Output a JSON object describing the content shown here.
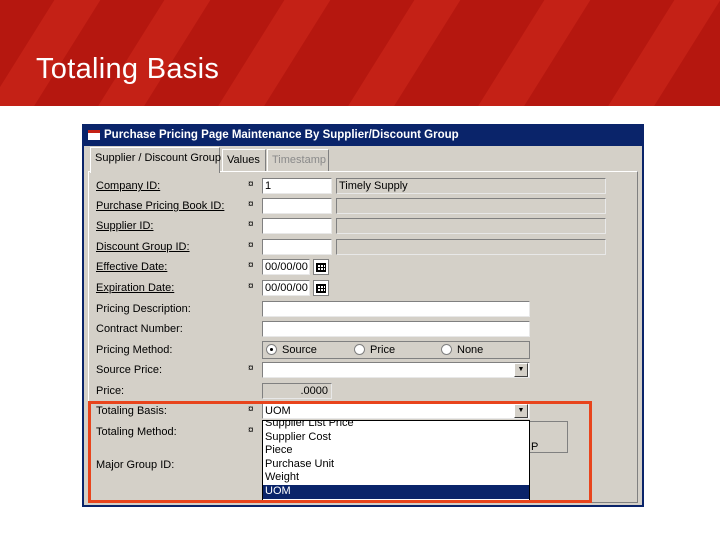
{
  "slide": {
    "title": "Totaling Basis"
  },
  "window": {
    "title": "Purchase Pricing Page Maintenance By Supplier/Discount Group"
  },
  "tabs": [
    {
      "label": "Supplier / Discount Group"
    },
    {
      "label": "Values"
    },
    {
      "label": "Timestamp"
    }
  ],
  "required_marker": "¤",
  "fields": {
    "company_id": {
      "label": "Company ID:",
      "value": "1",
      "description": "Timely Supply"
    },
    "purchase_pricing_book_id": {
      "label": "Purchase Pricing Book ID:",
      "value": ""
    },
    "supplier_id": {
      "label": "Supplier ID:",
      "value": ""
    },
    "discount_group_id": {
      "label": "Discount Group ID:",
      "value": ""
    },
    "effective_date": {
      "label": "Effective Date:",
      "value": "00/00/00"
    },
    "expiration_date": {
      "label": "Expiration Date:",
      "value": "00/00/00"
    },
    "pricing_description": {
      "label": "Pricing Description:",
      "value": ""
    },
    "contract_number": {
      "label": "Contract Number:",
      "value": ""
    },
    "pricing_method": {
      "label": "Pricing Method:",
      "options": [
        "Source",
        "Price",
        "None"
      ],
      "selected": "Source"
    },
    "source_price": {
      "label": "Source Price:",
      "value": ""
    },
    "price": {
      "label": "Price:",
      "value": ".0000"
    },
    "totaling_basis": {
      "label": "Totaling Basis:",
      "value": "UOM",
      "options": [
        "Supplier List Price",
        "Supplier Cost",
        "Piece",
        "Purchase Unit",
        "Weight",
        "UOM"
      ]
    },
    "totaling_method": {
      "label": "Totaling Method:",
      "partial_text": "P"
    },
    "major_group_id": {
      "label": "Major Group ID:"
    }
  },
  "colors": {
    "header_red": "#b5170f",
    "titlebar_blue": "#0a246a",
    "highlight_orange": "#e8441c",
    "selection_blue": "#0a246a"
  }
}
